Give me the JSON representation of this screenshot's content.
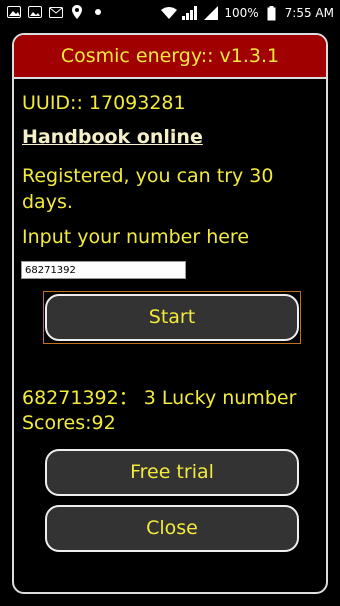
{
  "statusbar": {
    "battery": "100%",
    "time": "7:55 AM"
  },
  "dialog": {
    "title": "Cosmic energy:: v1.3.1",
    "uuid": "UUID:: 17093281",
    "handbook_link": "Handbook online",
    "registered": "Registered, you can try 30 days.",
    "input_label": "Input your number here",
    "input_value": "68271392",
    "start_label": "Start",
    "lucky_result": "68271392： 3 Lucky number",
    "scores": "Scores:92",
    "free_trial_label": "Free trial",
    "close_label": "Close"
  },
  "colors": {
    "header_bg": "#a00000",
    "text_yellow": "#f2ea3c",
    "button_bg": "#333333"
  }
}
